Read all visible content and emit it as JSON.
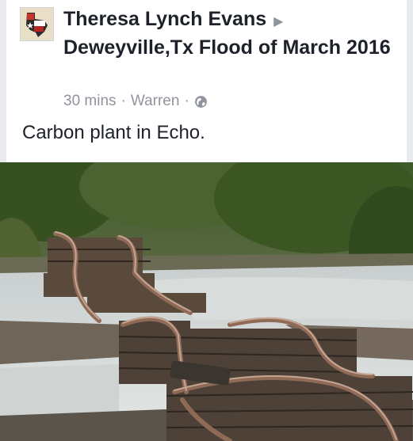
{
  "post": {
    "author": "Theresa Lynch Evans",
    "arrow": "▶",
    "group": "Deweyville,Tx Flood of March 2016",
    "time": "30 mins",
    "location": "Warren",
    "separator": "·",
    "audience_icon": "globe-icon",
    "text": "Carbon plant in Echo."
  },
  "photo": {
    "subject": "flood-washed railroad tracks"
  }
}
